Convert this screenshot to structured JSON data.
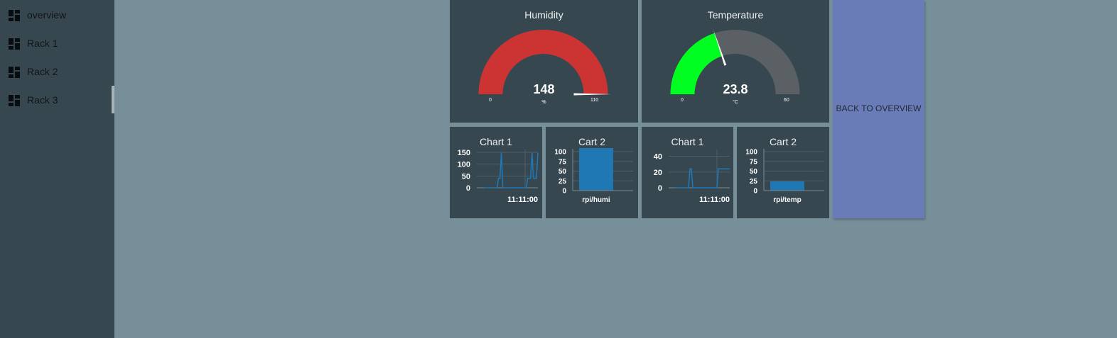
{
  "sidebar": {
    "items": [
      {
        "label": "overview",
        "icon": "dashboard-icon"
      },
      {
        "label": "Rack 1",
        "icon": "dashboard-icon"
      },
      {
        "label": "Rack 2",
        "icon": "dashboard-icon"
      },
      {
        "label": "Rack 3",
        "icon": "dashboard-icon"
      }
    ]
  },
  "gauges": {
    "humidity": {
      "title": "Humidity",
      "value": "148",
      "unit": "%",
      "min": "0",
      "max": "110",
      "fraction": 1.0,
      "fill_color": "#cc3434",
      "track_color": "#5a6063"
    },
    "temperature": {
      "title": "Temperature",
      "value": "23.8",
      "unit": "°C",
      "min": "0",
      "max": "60",
      "fraction": 0.397,
      "fill_color": "#00ff21",
      "track_color": "#5a6063"
    }
  },
  "charts": {
    "chart1_humi": {
      "title": "Chart 1",
      "time_label": "11:11:00"
    },
    "cart2_humi": {
      "title": "Cart 2"
    },
    "chart1_temp": {
      "title": "Chart 1",
      "time_label": "11:11:00"
    },
    "cart2_temp": {
      "title": "Cart 2"
    }
  },
  "chart_data": [
    {
      "type": "line",
      "title": "Chart 1",
      "yticks": [
        "150",
        "100",
        "50",
        "0"
      ],
      "ylim": [
        0,
        150
      ],
      "xlabel": "11:11:00",
      "color": "#1f77b4",
      "series": [
        {
          "values": [
            0,
            0,
            0,
            0,
            0,
            0,
            0,
            0,
            0,
            0,
            40,
            40,
            148,
            0,
            0,
            0,
            0,
            0,
            0,
            0,
            0,
            0,
            0,
            0,
            0,
            0,
            0,
            0,
            0,
            0,
            40,
            40,
            40,
            148,
            40,
            40,
            40,
            148
          ]
        }
      ]
    },
    {
      "type": "bar",
      "title": "Cart 2",
      "categories": [
        "rpi/humi"
      ],
      "values": [
        110
      ],
      "yticks": [
        "100",
        "75",
        "50",
        "25",
        "0"
      ],
      "ylim": [
        0,
        100
      ],
      "color": "#1f77b4"
    },
    {
      "type": "line",
      "title": "Chart 1",
      "yticks": [
        "40",
        "20",
        "0"
      ],
      "ylim": [
        0,
        45
      ],
      "xlabel": "11:11:00",
      "color": "#1f77b4",
      "series": [
        {
          "values": [
            0,
            0,
            0,
            0,
            0,
            0,
            0,
            0,
            0,
            0,
            24,
            24,
            0,
            0,
            0,
            0,
            0,
            0,
            0,
            0,
            0,
            0,
            0,
            0,
            0,
            0,
            0,
            0,
            0,
            0,
            24,
            24,
            24,
            24,
            24,
            24,
            24,
            24,
            24
          ]
        }
      ]
    },
    {
      "type": "bar",
      "title": "Cart 2",
      "categories": [
        "rpi/temp"
      ],
      "values": [
        23.8
      ],
      "yticks": [
        "100",
        "75",
        "50",
        "25",
        "0"
      ],
      "ylim": [
        0,
        100
      ],
      "color": "#1f77b4"
    }
  ],
  "back_button": {
    "label": "BACK TO OVERVIEW"
  }
}
